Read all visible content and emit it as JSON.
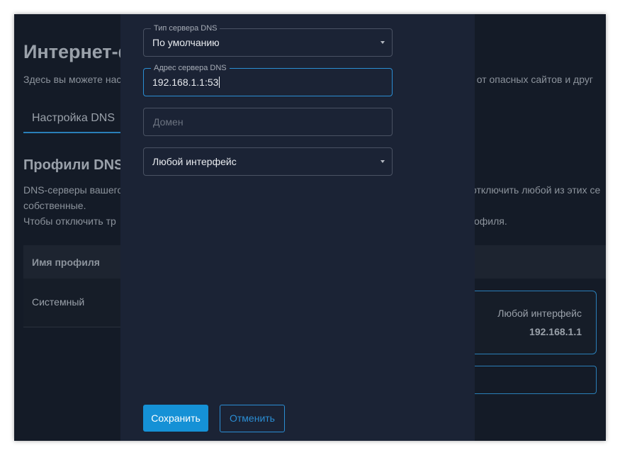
{
  "background": {
    "page_title": "Интернет-ф",
    "description_left": "Здесь вы можете нас",
    "description_right": "тв от опасных сайтов и друг",
    "tab_dns_settings": "Настройка DNS",
    "section_title": "Профили DNS",
    "line1_left": "DNS-серверы вашего",
    "line1_right": "отключить любой из этих се",
    "line2": "собственные.",
    "line3_left": "Чтобы отключить тр",
    "line3_right": "офиля.",
    "table_header_profile_name": "Имя профиля",
    "table_row_profile": "Системный",
    "interface_card": {
      "name": "Любой интерфейс",
      "ip": "192.168.1.1"
    }
  },
  "modal": {
    "dns_type": {
      "label": "Тип сервера DNS",
      "value": "По умолчанию"
    },
    "dns_address": {
      "label": "Адрес сервера DNS",
      "value": "192.168.1.1:53"
    },
    "domain": {
      "placeholder": "Домен"
    },
    "interface": {
      "value": "Любой интерфейс"
    },
    "save_label": "Сохранить",
    "cancel_label": "Отменить"
  },
  "colors": {
    "accent": "#1591d6",
    "modal_bg": "#1b2335",
    "page_bg": "#141b27"
  },
  "icons": {
    "dropdown": "chevron-down-icon"
  }
}
